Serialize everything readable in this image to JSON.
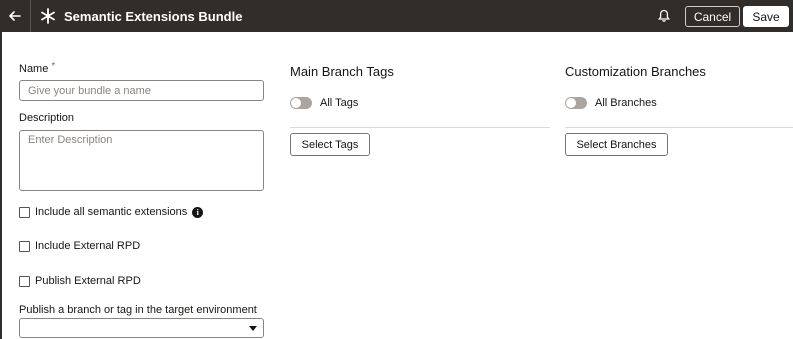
{
  "header": {
    "title": "Semantic Extensions Bundle",
    "cancel_label": "Cancel",
    "save_label": "Save"
  },
  "form": {
    "name_label": "Name",
    "required_mark": "*",
    "name_placeholder": "Give your bundle a name",
    "name_value": "",
    "description_label": "Description",
    "description_placeholder": "Enter Description",
    "description_value": "",
    "checkboxes": [
      {
        "label": "Include all semantic extensions",
        "checked": false
      },
      {
        "label": "Include External RPD",
        "checked": false
      },
      {
        "label": "Publish External RPD",
        "checked": false
      }
    ],
    "publish_label": "Publish a branch or tag in the target environment",
    "publish_value": ""
  },
  "main_branch_tags": {
    "title": "Main Branch Tags",
    "toggle_label": "All Tags",
    "toggle_on": false,
    "button_label": "Select Tags"
  },
  "customization_branches": {
    "title": "Customization Branches",
    "toggle_label": "All Branches",
    "toggle_on": false,
    "button_label": "Select Branches"
  },
  "colors": {
    "header_bg": "#312d2a",
    "toggle_off": "#aaa5a0"
  }
}
